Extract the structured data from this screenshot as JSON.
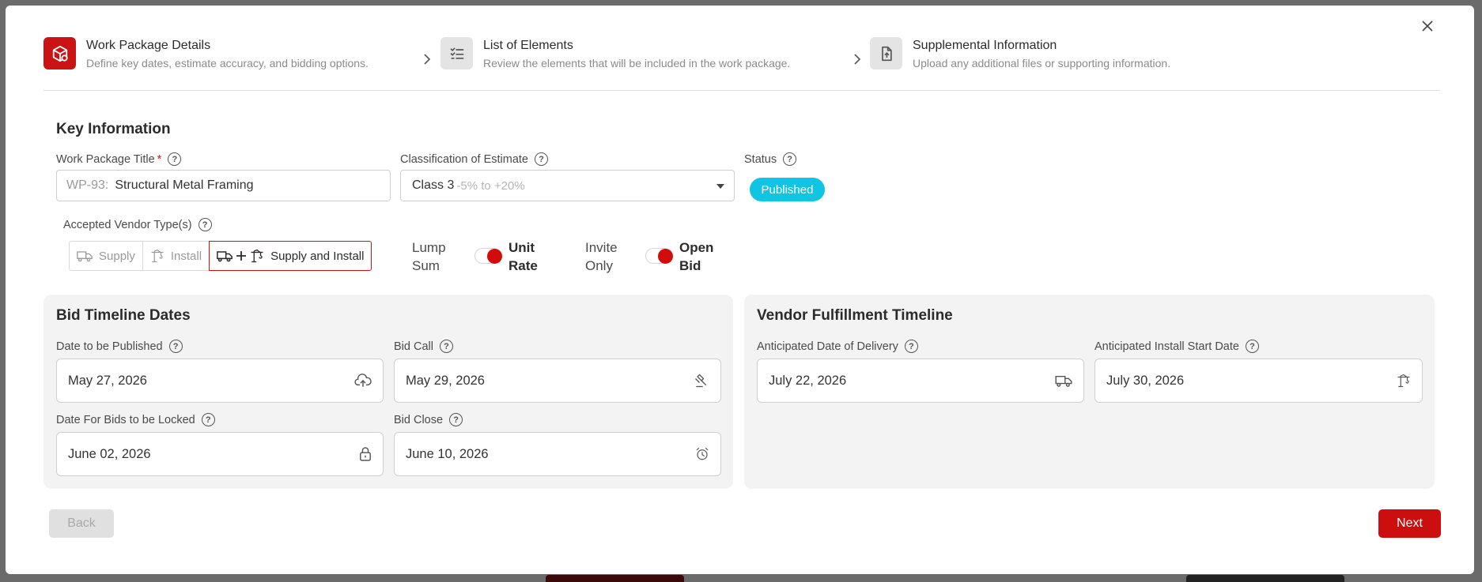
{
  "stepper": {
    "steps": [
      {
        "title": "Work Package Details",
        "desc": "Define key dates, estimate accuracy, and bidding options.",
        "icon": "box-icon",
        "active": true
      },
      {
        "title": "List of Elements",
        "desc": "Review the elements that will be included in the work package.",
        "icon": "checklist-icon",
        "active": false
      },
      {
        "title": "Supplemental Information",
        "desc": "Upload any additional files or supporting information.",
        "icon": "file-upload-icon",
        "active": false
      }
    ],
    "close_icon": "close-icon"
  },
  "key_info": {
    "title": "Key Information",
    "wp_title_label": "Work Package Title",
    "required_mark": "*",
    "wp_prefix": "WP-93:",
    "wp_title_value": "Structural Metal Framing",
    "classification_label": "Classification of Estimate",
    "classification_value": "Class 3",
    "classification_range": "-5% to +20%",
    "status_label": "Status",
    "status_value": "Published",
    "vendor_types_label": "Accepted Vendor Type(s)",
    "vendor_options": [
      "Supply",
      "Install",
      "Supply and Install"
    ],
    "vendor_selected": "Supply and Install",
    "pricing_toggle": {
      "left": [
        "Lump",
        "Sum"
      ],
      "right": [
        "Unit",
        "Rate"
      ],
      "selected": "Unit Rate"
    },
    "bid_toggle": {
      "left": [
        "Invite",
        "Only"
      ],
      "right": [
        "Open",
        "Bid"
      ],
      "selected": "Open Bid"
    },
    "help_glyph": "?"
  },
  "bid_timeline": {
    "title": "Bid Timeline Dates",
    "fields": [
      {
        "label": "Date to be Published",
        "value": "May 27, 2026",
        "icon": "cloud-upload-icon"
      },
      {
        "label": "Bid Call",
        "value": "May 29, 2026",
        "icon": "gavel-icon"
      },
      {
        "label": "Date For Bids to be Locked",
        "value": "June 02, 2026",
        "icon": "lock-icon"
      },
      {
        "label": "Bid Close",
        "value": "June 10, 2026",
        "icon": "alarm-clock-icon"
      }
    ]
  },
  "vendor_timeline": {
    "title": "Vendor Fulfillment Timeline",
    "fields": [
      {
        "label": "Anticipated Date of Delivery",
        "value": "July 22, 2026",
        "icon": "truck-icon"
      },
      {
        "label": "Anticipated Install Start Date",
        "value": "July 30, 2026",
        "icon": "crane-icon"
      }
    ]
  },
  "footer": {
    "back_label": "Back",
    "next_label": "Next"
  },
  "colors": {
    "accent": "#cc1313",
    "status": "#10c5e3",
    "panel": "#f3f3f3"
  }
}
